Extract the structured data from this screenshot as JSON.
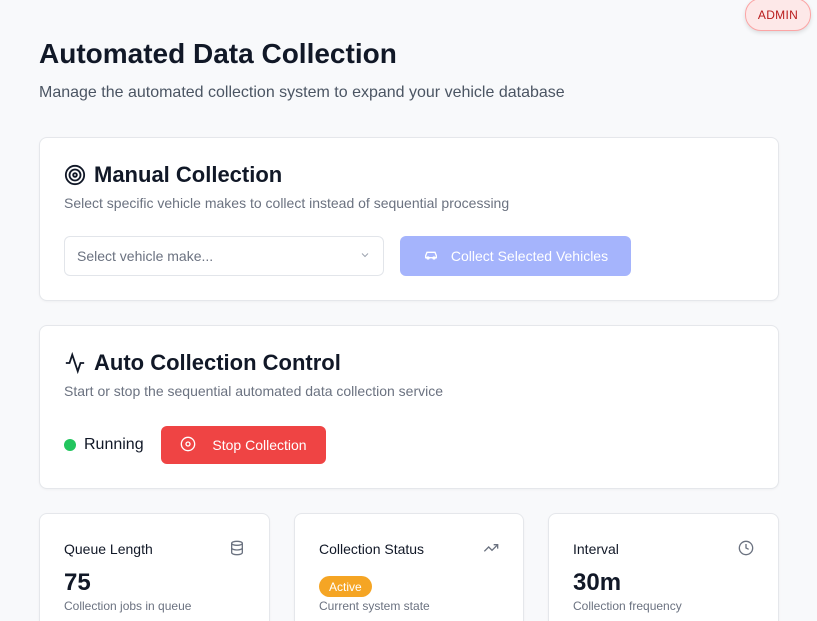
{
  "header": {
    "admin_badge": "ADMIN",
    "title": "Automated Data Collection",
    "subtitle": "Manage the automated collection system to expand your vehicle database"
  },
  "manual": {
    "icon": "target-icon",
    "title": "Manual Collection",
    "description": "Select specific vehicle makes to collect instead of sequential processing",
    "select_placeholder": "Select vehicle make...",
    "collect_button": "Collect Selected Vehicles",
    "collect_button_icon": "car-icon"
  },
  "auto": {
    "icon": "activity-icon",
    "title": "Auto Collection Control",
    "description": "Start or stop the sequential automated data collection service",
    "status": "Running",
    "stop_button": "Stop Collection",
    "stop_button_icon": "stop-circle-icon"
  },
  "stats": {
    "queue": {
      "label": "Queue Length",
      "value": "75",
      "sub": "Collection jobs in queue",
      "icon": "database-icon"
    },
    "status": {
      "label": "Collection Status",
      "badge": "Active",
      "sub": "Current system state",
      "icon": "trending-up-icon"
    },
    "interval": {
      "label": "Interval",
      "value": "30m",
      "sub": "Collection frequency",
      "icon": "clock-icon"
    }
  },
  "colors": {
    "running": "#22c55e",
    "stop": "#ef4444",
    "collect_disabled": "#a5b4fc",
    "active_badge": "#f5a524"
  }
}
